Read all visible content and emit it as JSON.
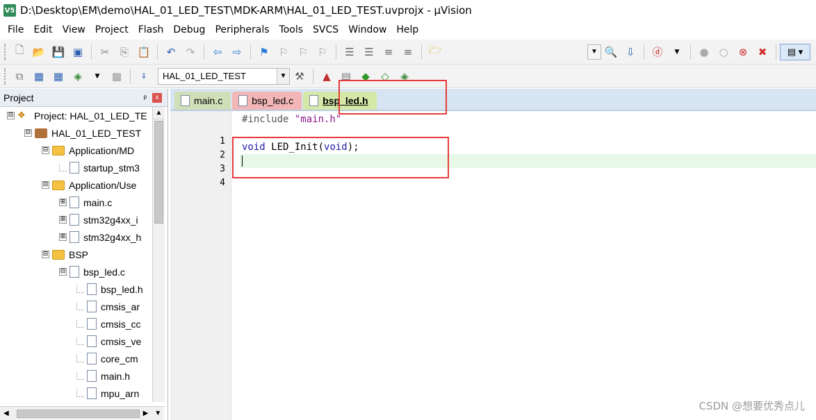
{
  "window": {
    "title": "D:\\Desktop\\EM\\demo\\HAL_01_LED_TEST\\MDK-ARM\\HAL_01_LED_TEST.uvprojx - µVision",
    "app_icon": "V5"
  },
  "menu": [
    "File",
    "Edit",
    "View",
    "Project",
    "Flash",
    "Debug",
    "Peripherals",
    "Tools",
    "SVCS",
    "Window",
    "Help"
  ],
  "toolbar2": {
    "target": "HAL_01_LED_TEST"
  },
  "project_panel": {
    "title": "Project",
    "pin": "ᵖ",
    "close": "x",
    "tree": [
      {
        "label": "Project: HAL_01_LED_TE",
        "type": "project",
        "expander": "⊟",
        "indent": 0
      },
      {
        "label": "HAL_01_LED_TEST",
        "type": "target",
        "expander": "⊟",
        "indent": 1
      },
      {
        "label": "Application/MD",
        "type": "folder",
        "expander": "⊟",
        "indent": 2
      },
      {
        "label": "startup_stm3",
        "type": "file",
        "expander": "",
        "indent": 3
      },
      {
        "label": "Application/Use",
        "type": "folder",
        "expander": "⊟",
        "indent": 2
      },
      {
        "label": "main.c",
        "type": "file",
        "expander": "⊞",
        "indent": 3
      },
      {
        "label": "stm32g4xx_i",
        "type": "file",
        "expander": "⊞",
        "indent": 3
      },
      {
        "label": "stm32g4xx_h",
        "type": "file",
        "expander": "⊞",
        "indent": 3
      },
      {
        "label": "BSP",
        "type": "folder",
        "expander": "⊟",
        "indent": 2
      },
      {
        "label": "bsp_led.c",
        "type": "file",
        "expander": "⊟",
        "indent": 3
      },
      {
        "label": "bsp_led.h",
        "type": "file",
        "expander": "",
        "indent": 4
      },
      {
        "label": "cmsis_ar",
        "type": "file",
        "expander": "",
        "indent": 4
      },
      {
        "label": "cmsis_cc",
        "type": "file",
        "expander": "",
        "indent": 4
      },
      {
        "label": "cmsis_ve",
        "type": "file",
        "expander": "",
        "indent": 4
      },
      {
        "label": "core_cm",
        "type": "file",
        "expander": "",
        "indent": 4
      },
      {
        "label": "main.h",
        "type": "file",
        "expander": "",
        "indent": 4
      },
      {
        "label": "mpu_arn",
        "type": "file",
        "expander": "",
        "indent": 4
      }
    ]
  },
  "editor": {
    "tabs": [
      {
        "label": "main.c",
        "style": "tab-main"
      },
      {
        "label": "bsp_led.c",
        "style": "tab-bspc"
      },
      {
        "label": "bsp_led.h",
        "style": "tab-bsph"
      }
    ],
    "line_numbers": [
      "1",
      "2",
      "3",
      "4"
    ],
    "code": {
      "line1_directive": "#include ",
      "line1_string": "\"main.h\"",
      "line3_kw1": "void",
      "line3_mid": " LED_Init(",
      "line3_kw2": "void",
      "line3_end": ");"
    }
  },
  "watermark": "CSDN @想要优秀点儿",
  "colors": {
    "highlight_box": "#e8393a",
    "current_line": "#e8f8e8",
    "keyword": "#1a1aa6",
    "string": "#8b1a8b"
  }
}
